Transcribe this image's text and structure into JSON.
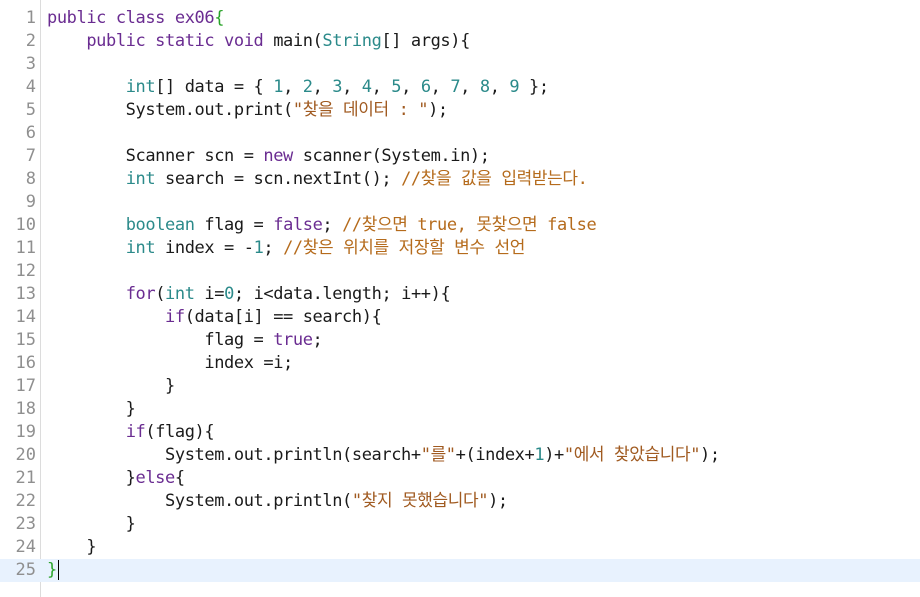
{
  "editor": {
    "lines": [
      [
        {
          "t": "public class ex06",
          "c": "kw"
        },
        {
          "t": "{",
          "c": "br"
        }
      ],
      [
        {
          "t": "    public static void ",
          "c": "kw"
        },
        {
          "t": "main(",
          "c": ""
        },
        {
          "t": "String",
          "c": "ty"
        },
        {
          "t": "[] args){",
          "c": ""
        }
      ],
      [],
      [
        {
          "t": "        ",
          "c": ""
        },
        {
          "t": "int",
          "c": "ty"
        },
        {
          "t": "[] data = { ",
          "c": ""
        },
        {
          "t": "1",
          "c": "num"
        },
        {
          "t": ", ",
          "c": ""
        },
        {
          "t": "2",
          "c": "num"
        },
        {
          "t": ", ",
          "c": ""
        },
        {
          "t": "3",
          "c": "num"
        },
        {
          "t": ", ",
          "c": ""
        },
        {
          "t": "4",
          "c": "num"
        },
        {
          "t": ", ",
          "c": ""
        },
        {
          "t": "5",
          "c": "num"
        },
        {
          "t": ", ",
          "c": ""
        },
        {
          "t": "6",
          "c": "num"
        },
        {
          "t": ", ",
          "c": ""
        },
        {
          "t": "7",
          "c": "num"
        },
        {
          "t": ", ",
          "c": ""
        },
        {
          "t": "8",
          "c": "num"
        },
        {
          "t": ", ",
          "c": ""
        },
        {
          "t": "9",
          "c": "num"
        },
        {
          "t": " };",
          "c": ""
        }
      ],
      [
        {
          "t": "        System.out.print(",
          "c": ""
        },
        {
          "t": "\"찾을 데이터 : \"",
          "c": "str"
        },
        {
          "t": ");",
          "c": ""
        }
      ],
      [],
      [
        {
          "t": "        Scanner scn = ",
          "c": ""
        },
        {
          "t": "new",
          "c": "kw"
        },
        {
          "t": " scanner(System.in);",
          "c": ""
        }
      ],
      [
        {
          "t": "        ",
          "c": ""
        },
        {
          "t": "int",
          "c": "ty"
        },
        {
          "t": " search = scn.nextInt(); ",
          "c": ""
        },
        {
          "t": "//찾을 값을 입력받는다.",
          "c": "cm"
        }
      ],
      [],
      [
        {
          "t": "        ",
          "c": ""
        },
        {
          "t": "boolean",
          "c": "ty"
        },
        {
          "t": " flag = ",
          "c": ""
        },
        {
          "t": "false",
          "c": "kw"
        },
        {
          "t": "; ",
          "c": ""
        },
        {
          "t": "//찾으면 true, 못찾으면 false",
          "c": "cm"
        }
      ],
      [
        {
          "t": "        ",
          "c": ""
        },
        {
          "t": "int",
          "c": "ty"
        },
        {
          "t": " index = -",
          "c": ""
        },
        {
          "t": "1",
          "c": "num"
        },
        {
          "t": "; ",
          "c": ""
        },
        {
          "t": "//찾은 위치를 저장할 변수 선언",
          "c": "cm"
        }
      ],
      [],
      [
        {
          "t": "        ",
          "c": ""
        },
        {
          "t": "for",
          "c": "kw"
        },
        {
          "t": "(",
          "c": ""
        },
        {
          "t": "int",
          "c": "ty"
        },
        {
          "t": " i=",
          "c": ""
        },
        {
          "t": "0",
          "c": "num"
        },
        {
          "t": "; i<data.length; i++){",
          "c": ""
        }
      ],
      [
        {
          "t": "            ",
          "c": ""
        },
        {
          "t": "if",
          "c": "kw"
        },
        {
          "t": "(data[i] == search){",
          "c": ""
        }
      ],
      [
        {
          "t": "                flag = ",
          "c": ""
        },
        {
          "t": "true",
          "c": "kw"
        },
        {
          "t": ";",
          "c": ""
        }
      ],
      [
        {
          "t": "                index =i;",
          "c": ""
        }
      ],
      [
        {
          "t": "            }",
          "c": ""
        }
      ],
      [
        {
          "t": "        }",
          "c": ""
        }
      ],
      [
        {
          "t": "        ",
          "c": ""
        },
        {
          "t": "if",
          "c": "kw"
        },
        {
          "t": "(flag){",
          "c": ""
        }
      ],
      [
        {
          "t": "            System.out.println(search+",
          "c": ""
        },
        {
          "t": "\"를\"",
          "c": "str"
        },
        {
          "t": "+(index+",
          "c": ""
        },
        {
          "t": "1",
          "c": "num"
        },
        {
          "t": ")+",
          "c": ""
        },
        {
          "t": "\"에서 찾았습니다\"",
          "c": "str"
        },
        {
          "t": ");",
          "c": ""
        }
      ],
      [
        {
          "t": "        }",
          "c": ""
        },
        {
          "t": "else",
          "c": "kw"
        },
        {
          "t": "{",
          "c": ""
        }
      ],
      [
        {
          "t": "            System.out.println(",
          "c": ""
        },
        {
          "t": "\"찾지 못했습니다\"",
          "c": "str"
        },
        {
          "t": ");",
          "c": ""
        }
      ],
      [
        {
          "t": "        }",
          "c": ""
        }
      ],
      [
        {
          "t": "    }",
          "c": ""
        }
      ],
      [
        {
          "t": "}",
          "c": "br"
        }
      ]
    ],
    "current_line": 25
  }
}
